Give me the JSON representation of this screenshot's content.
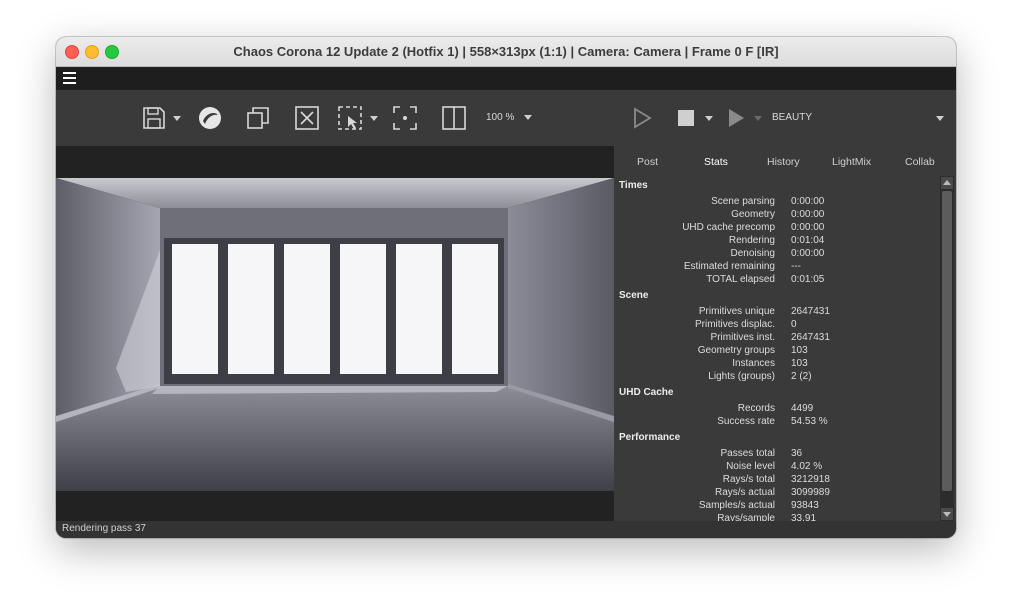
{
  "window": {
    "title": "Chaos Corona 12 Update 2 (Hotfix 1) | 558×313px (1:1) | Camera: Camera | Frame 0 F [IR]"
  },
  "menubar": {
    "menu_icon": "hamburger-icon"
  },
  "toolbar": {
    "icons": [
      "save-icon",
      "corona-logo-icon",
      "copy-icon",
      "clear-icon",
      "region-select-icon",
      "focus-icon",
      "compare-icon",
      "render-icon",
      "stop-icon",
      "interactive-render-icon"
    ],
    "zoom": "100 %",
    "channel": "BEAUTY"
  },
  "tabs": [
    "Post",
    "Stats",
    "History",
    "LightMix",
    "Collab"
  ],
  "active_tab": "Stats",
  "stats": {
    "times": {
      "title": "Times",
      "rows": [
        {
          "label": "Scene parsing",
          "value": "0:00:00"
        },
        {
          "label": "Geometry",
          "value": "0:00:00"
        },
        {
          "label": "UHD cache precomp",
          "value": "0:00:00"
        },
        {
          "label": "Rendering",
          "value": "0:01:04"
        },
        {
          "label": "Denoising",
          "value": "0:00:00"
        },
        {
          "label": "Estimated remaining",
          "value": "---"
        },
        {
          "label": "TOTAL elapsed",
          "value": "0:01:05"
        }
      ]
    },
    "scene": {
      "title": "Scene",
      "rows": [
        {
          "label": "Primitives unique",
          "value": "2647431"
        },
        {
          "label": "Primitives displac.",
          "value": "0"
        },
        {
          "label": "Primitives inst.",
          "value": "2647431"
        },
        {
          "label": "Geometry groups",
          "value": "103"
        },
        {
          "label": "Instances",
          "value": "103"
        },
        {
          "label": "Lights (groups)",
          "value": "2 (2)"
        }
      ]
    },
    "uhd": {
      "title": "UHD Cache",
      "rows": [
        {
          "label": "Records",
          "value": "4499"
        },
        {
          "label": "Success rate",
          "value": "54.53 %"
        }
      ]
    },
    "performance": {
      "title": "Performance",
      "rows": [
        {
          "label": "Passes total",
          "value": "36"
        },
        {
          "label": "Noise level",
          "value": "4.02 %"
        },
        {
          "label": "Rays/s total",
          "value": "3212918"
        },
        {
          "label": "Rays/s actual",
          "value": "3099989"
        },
        {
          "label": "Samples/s actual",
          "value": "93843"
        },
        {
          "label": "Rays/sample",
          "value": "33.91"
        }
      ]
    }
  },
  "status": "Rendering pass 37",
  "colors": {
    "window_bg": "#3a3a3a",
    "menubar_bg": "#1e1e1e",
    "text": "#dcdcdc"
  }
}
